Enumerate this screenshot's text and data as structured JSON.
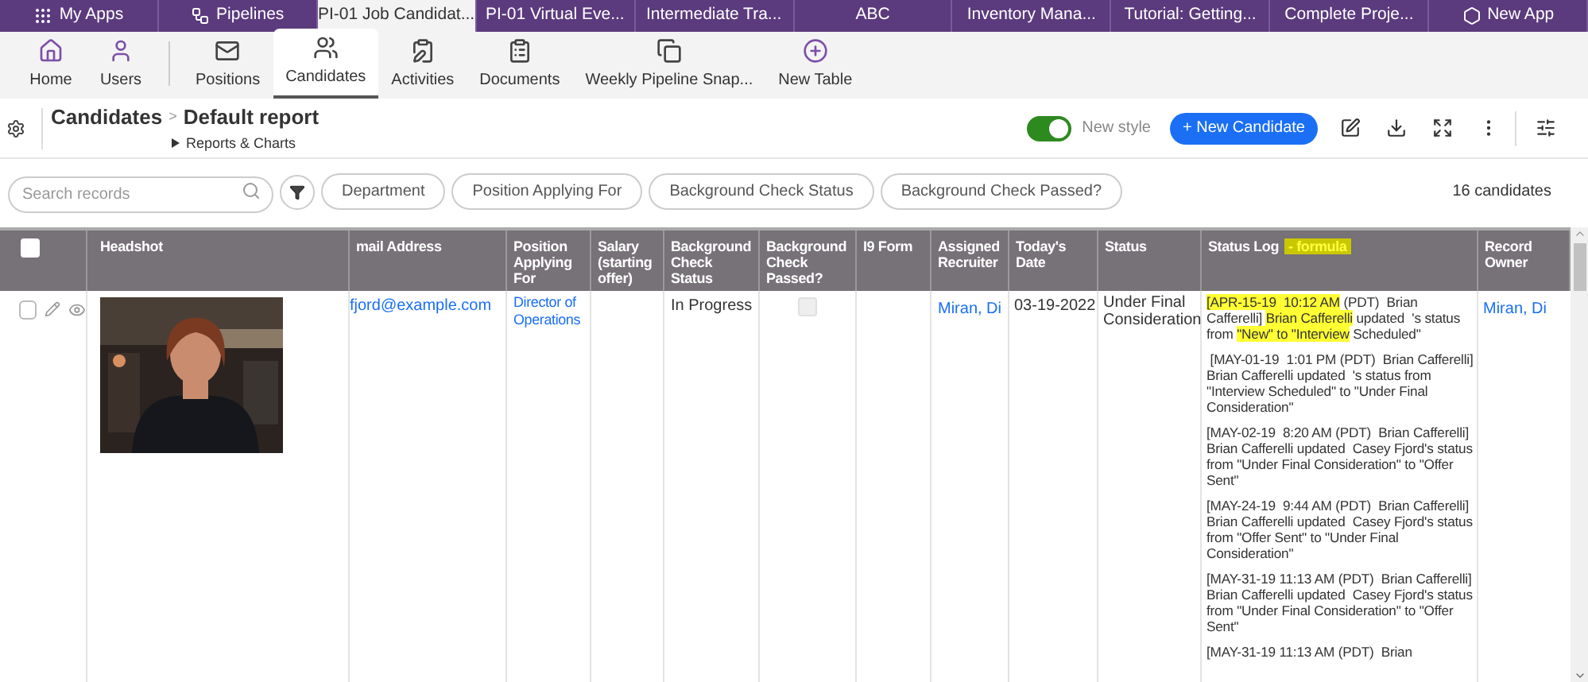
{
  "app_tabs": [
    {
      "label": "My Apps",
      "selected": false
    },
    {
      "label": "Pipelines",
      "selected": false
    },
    {
      "label": "PI-01 Job Candidat...",
      "selected": true
    },
    {
      "label": "PI-01 Virtual Eve...",
      "selected": false
    },
    {
      "label": "Intermediate Tra...",
      "selected": false
    },
    {
      "label": "ABC",
      "selected": false
    },
    {
      "label": "Inventory Mana...",
      "selected": false
    },
    {
      "label": "Tutorial: Getting...",
      "selected": false
    },
    {
      "label": "Complete Proje...",
      "selected": false
    },
    {
      "label": "New App",
      "selected": false
    }
  ],
  "table_nav": [
    {
      "label": "Home",
      "selected": false
    },
    {
      "label": "Users",
      "selected": false
    },
    {
      "label": "Positions",
      "selected": false
    },
    {
      "label": "Candidates",
      "selected": true
    },
    {
      "label": "Activities",
      "selected": false
    },
    {
      "label": "Documents",
      "selected": false
    },
    {
      "label": "Weekly Pipeline Snap...",
      "selected": false
    },
    {
      "label": "New Table",
      "selected": false
    }
  ],
  "header": {
    "table": "Candidates",
    "separator": ">",
    "report": "Default report",
    "reports_link": "Reports & Charts",
    "new_style": {
      "label": "New style",
      "on": true
    },
    "new_button": "+ New Candidate"
  },
  "filters": {
    "search_placeholder": "Search records",
    "pills": [
      "Department",
      "Position Applying For",
      "Background Check Status",
      "Background Check Passed?"
    ],
    "count": "16 candidates"
  },
  "table": {
    "select_all_checked": false,
    "columns": [
      {
        "label": "Headshot"
      },
      {
        "label": "mail Address"
      },
      {
        "label": "Position Applying For"
      },
      {
        "label": "Salary (starting offer)"
      },
      {
        "label": "Background Check Status"
      },
      {
        "label": "Background Check Passed?"
      },
      {
        "label": "I9 Form"
      },
      {
        "label": "Assigned Recruiter"
      },
      {
        "label": "Today's Date"
      },
      {
        "label": "Status"
      },
      {
        "label": "Status Log",
        "suffix": "- formula"
      },
      {
        "label": "Record Owner"
      }
    ],
    "rows": [
      {
        "checked": false,
        "email": "fjord@example.com",
        "position": "Director of Operations",
        "background_check_status": "In Progress",
        "background_check_passed": false,
        "recruiter": "Miran, Di",
        "todays_date": "03-19-2022",
        "status": "Under Final Consideration",
        "record_owner": "Miran, Di",
        "status_log": [
          [
            {
              "text": "[APR-15-19  10:12 AM",
              "highlighted": true
            },
            {
              "text": " (PDT)  Brian Cafferelli] ",
              "highlighted": false
            },
            {
              "text": "Brian Cafferelli",
              "highlighted": true
            },
            {
              "text": " updated  's status from ",
              "highlighted": false
            },
            {
              "text": "\"New\" to \"Interview",
              "highlighted": true
            },
            {
              "text": " Scheduled\"",
              "highlighted": false
            }
          ],
          [
            {
              "text": " [MAY-01-19  1:01 PM (PDT)  Brian Cafferelli] Brian Cafferelli updated  's status from \"Interview Scheduled\" to \"Under Final Consideration\"",
              "highlighted": false
            }
          ],
          [
            {
              "text": "[MAY-02-19  8:20 AM (PDT)  Brian Cafferelli] Brian Cafferelli updated  Casey Fjord's status from \"Under Final Consideration\" to \"Offer Sent\"",
              "highlighted": false
            }
          ],
          [
            {
              "text": "[MAY-24-19  9:44 AM (PDT)  Brian Cafferelli] Brian Cafferelli updated  Casey Fjord's status from \"Offer Sent\" to \"Under Final Consideration\"",
              "highlighted": false
            }
          ],
          [
            {
              "text": "[MAY-31-19 11:13 AM (PDT)  Brian Cafferelli] Brian Cafferelli updated  Casey Fjord's status from \"Under Final Consideration\" to \"Offer Sent\"",
              "highlighted": false
            }
          ],
          [
            {
              "text": "[MAY-31-19 11:13 AM (PDT)  Brian",
              "highlighted": false
            }
          ]
        ]
      }
    ]
  }
}
